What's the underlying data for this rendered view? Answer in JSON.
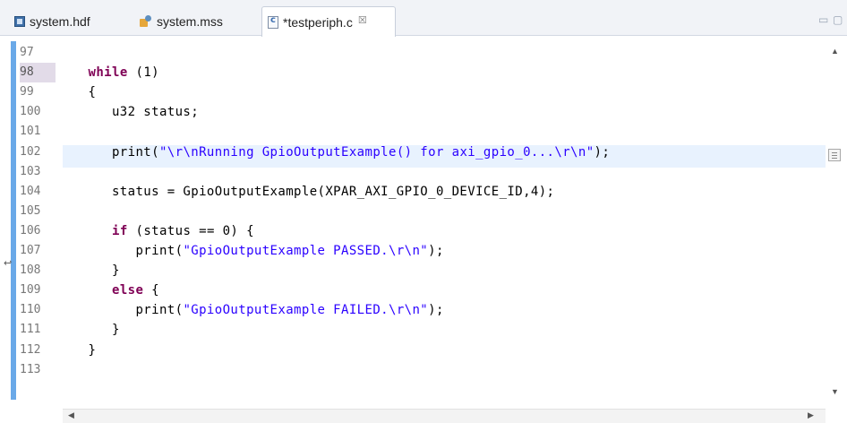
{
  "tabs": [
    {
      "label": "system.hdf",
      "icon": "hdf-file-icon",
      "active": false
    },
    {
      "label": "system.mss",
      "icon": "mss-file-icon",
      "active": false
    },
    {
      "label": "*testperiph.c",
      "icon": "c-file-icon",
      "active": true,
      "close": "☒"
    }
  ],
  "window_controls": {
    "minimize": "▭",
    "maximize": "▢"
  },
  "editor": {
    "line_numbers": [
      "97",
      "98",
      "99",
      "100",
      "101",
      "102",
      "103",
      "104",
      "105",
      "106",
      "107",
      "108",
      "109",
      "110",
      "111",
      "112",
      "113"
    ],
    "lines": [
      {
        "parts": []
      },
      {
        "parts": [
          {
            "t": "   "
          },
          {
            "t": "while",
            "kw": true
          },
          {
            "t": " (1)"
          }
        ]
      },
      {
        "parts": [
          {
            "t": "   {"
          }
        ]
      },
      {
        "parts": [
          {
            "t": "      u32 status;"
          }
        ]
      },
      {
        "parts": []
      },
      {
        "parts": [
          {
            "t": "      print("
          },
          {
            "t": "\"\\r\\nRunning GpioOutputExample() for axi_gpio_0...\\r\\n\"",
            "str": true
          },
          {
            "t": ");"
          }
        ]
      },
      {
        "parts": []
      },
      {
        "parts": [
          {
            "t": "      status = GpioOutputExample(XPAR_AXI_GPIO_0_DEVICE_ID,4);"
          }
        ]
      },
      {
        "parts": []
      },
      {
        "parts": [
          {
            "t": "      "
          },
          {
            "t": "if",
            "kw": true
          },
          {
            "t": " (status == 0) {"
          }
        ]
      },
      {
        "parts": [
          {
            "t": "         print("
          },
          {
            "t": "\"GpioOutputExample PASSED.\\r\\n\"",
            "str": true
          },
          {
            "t": ");"
          }
        ]
      },
      {
        "parts": [
          {
            "t": "      }"
          }
        ]
      },
      {
        "parts": [
          {
            "t": "      "
          },
          {
            "t": "else",
            "kw": true
          },
          {
            "t": " {"
          }
        ]
      },
      {
        "parts": [
          {
            "t": "         print("
          },
          {
            "t": "\"GpioOutputExample FAILED.\\r\\n\"",
            "str": true
          },
          {
            "t": ");"
          }
        ]
      },
      {
        "parts": [
          {
            "t": "      }"
          }
        ]
      },
      {
        "parts": [
          {
            "t": "   }"
          }
        ]
      },
      {
        "parts": []
      }
    ]
  },
  "colors": {
    "keyword": "#7f0055",
    "string": "#2a00ff",
    "current_line": "#e8f2fe",
    "ruler": "#6aa9e8"
  }
}
